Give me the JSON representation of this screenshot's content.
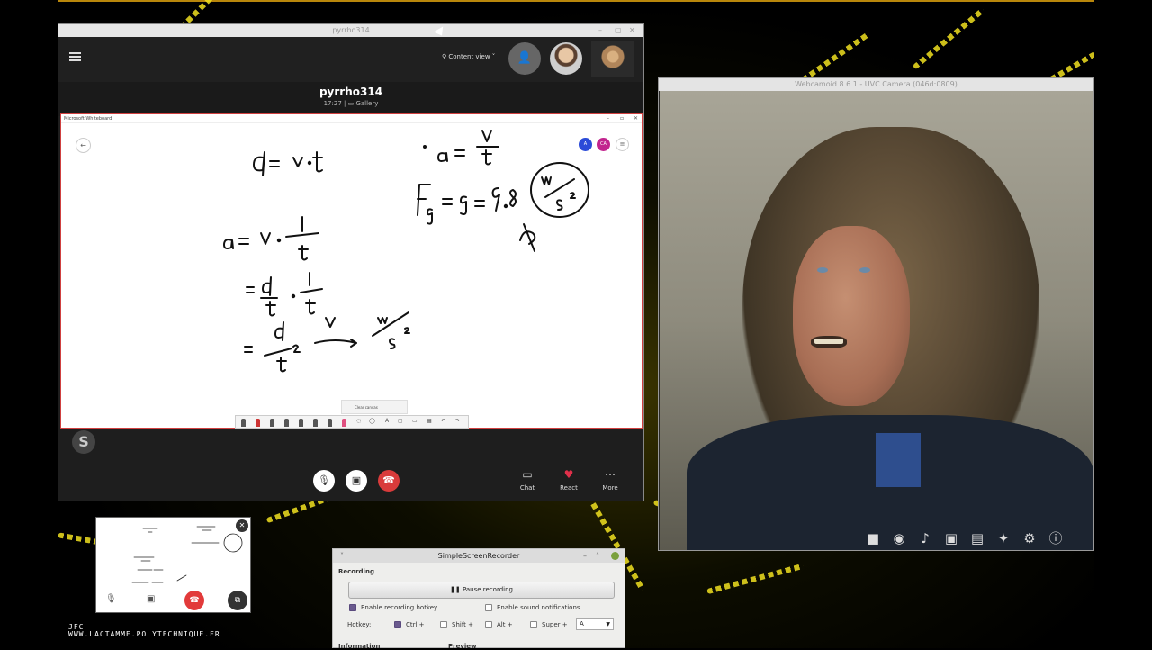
{
  "skype": {
    "window_title": "pyrrho314",
    "content_view_label": "Content view",
    "call_name": "pyrrho314",
    "call_time": "17:27",
    "view_label": "Gallery",
    "whiteboard_title": "Microsoft Whiteboard",
    "wb_users": [
      "A",
      "CA"
    ],
    "clear_canvas": "Clear canvas",
    "actions": [
      {
        "label": "Chat",
        "icon": "chat-icon"
      },
      {
        "label": "React",
        "icon": "heart-icon"
      },
      {
        "label": "More",
        "icon": "more-icon"
      }
    ],
    "colors": {
      "hangup": "#d93b3b",
      "user_a": "#2b4bd8",
      "user_ca": "#c2248e"
    }
  },
  "webcam": {
    "window_title": "Webcamoid 8.6.1 - UVC Camera (046d:0809)"
  },
  "ssr": {
    "title": "SimpleScreenRecorder",
    "section_recording": "Recording",
    "pause_button": "Pause recording",
    "enable_hotkey": "Enable recording hotkey",
    "enable_sound": "Enable sound notifications",
    "hotkey_label": "Hotkey:",
    "mods": [
      "Ctrl +",
      "Shift +",
      "Alt +",
      "Super +"
    ],
    "key_value": "A",
    "section_information": "Information",
    "section_preview": "Preview"
  },
  "credit": {
    "line1": "JFC",
    "line2": "WWW.LACTAMME.POLYTECHNIQUE.FR"
  }
}
